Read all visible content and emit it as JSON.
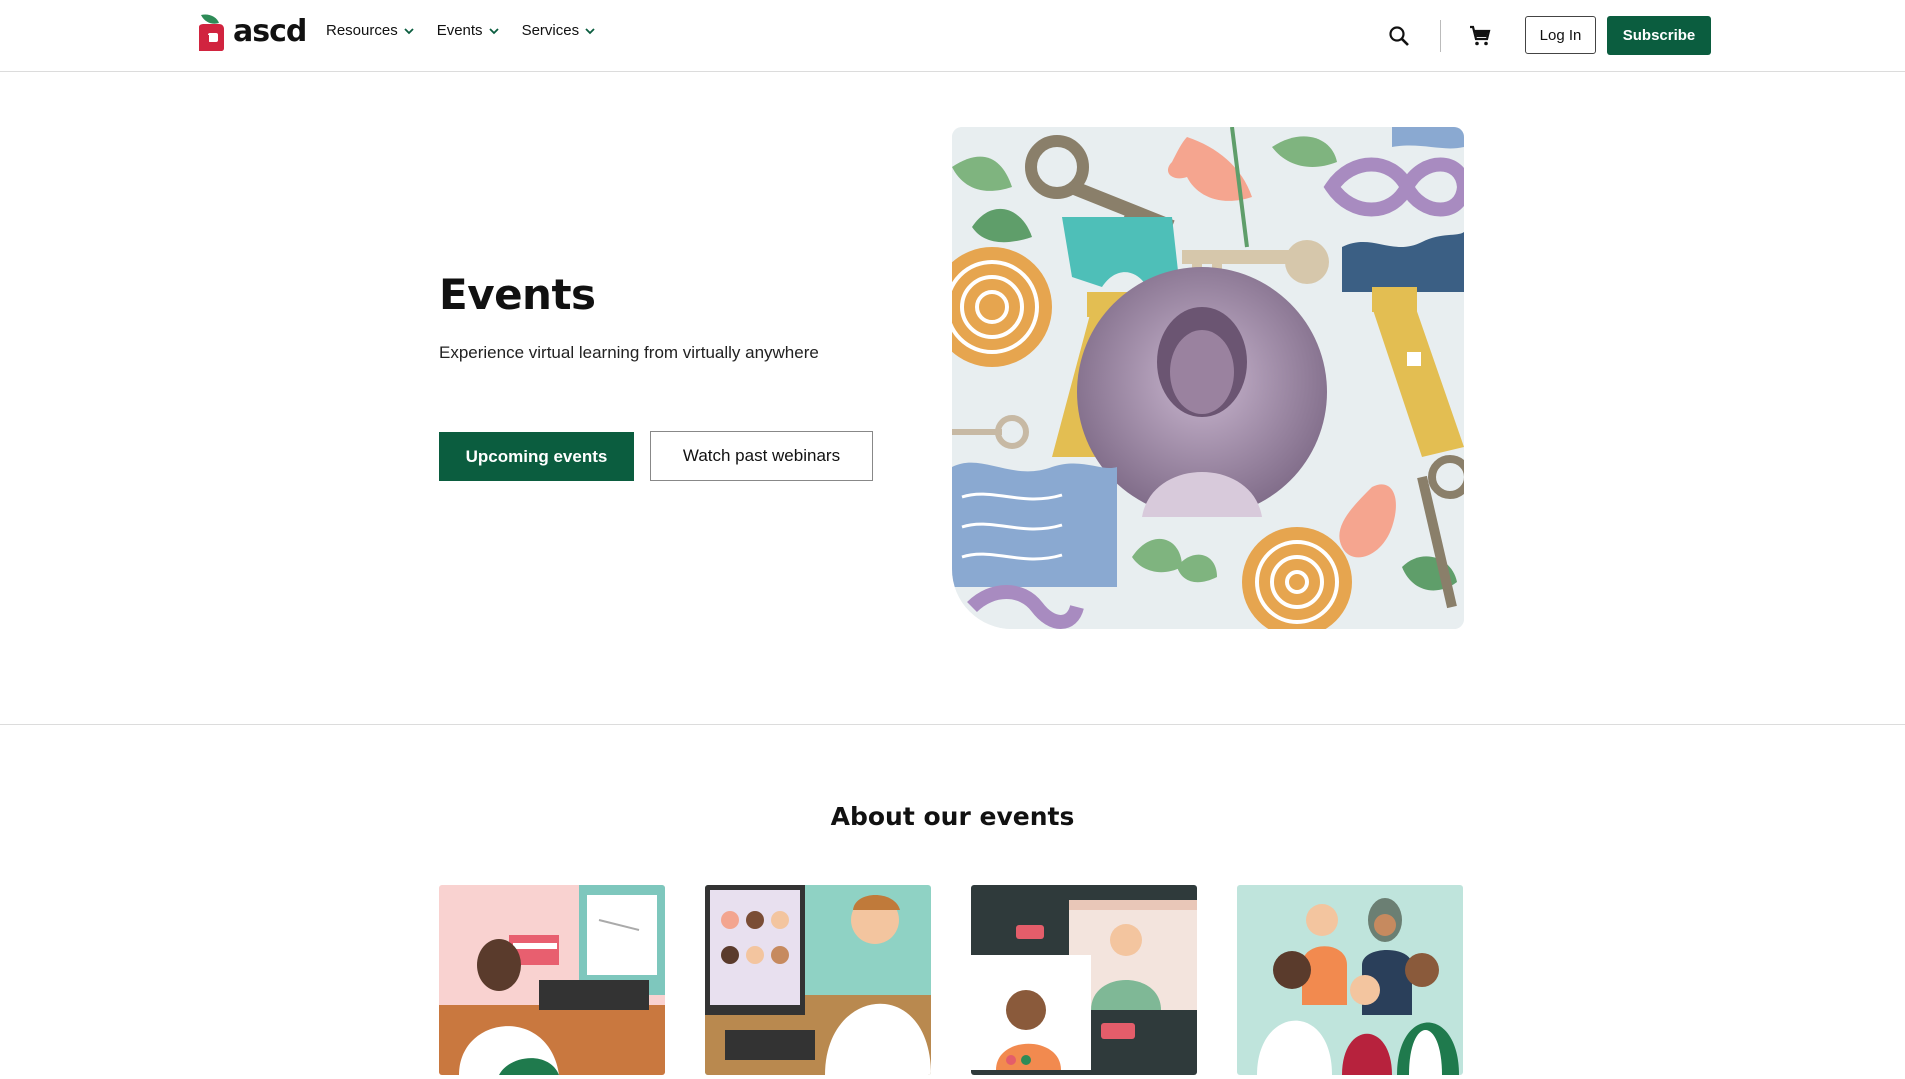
{
  "header": {
    "logo_text": "ascd",
    "nav": [
      {
        "label": "Resources"
      },
      {
        "label": "Events"
      },
      {
        "label": "Services"
      }
    ],
    "login_label": "Log In",
    "subscribe_label": "Subscribe"
  },
  "hero": {
    "title": "Events",
    "subtitle": "Experience virtual learning from virtually anywhere",
    "primary_button": "Upcoming events",
    "secondary_button": "Watch past webinars"
  },
  "about": {
    "title": "About our events"
  },
  "colors": {
    "brand_green": "#0b5d3f",
    "logo_red": "#d1243f",
    "logo_leaf": "#2e8b57"
  },
  "icons": [
    "search-icon",
    "cart-icon",
    "chevron-down-icon",
    "logo-apple-icon"
  ]
}
